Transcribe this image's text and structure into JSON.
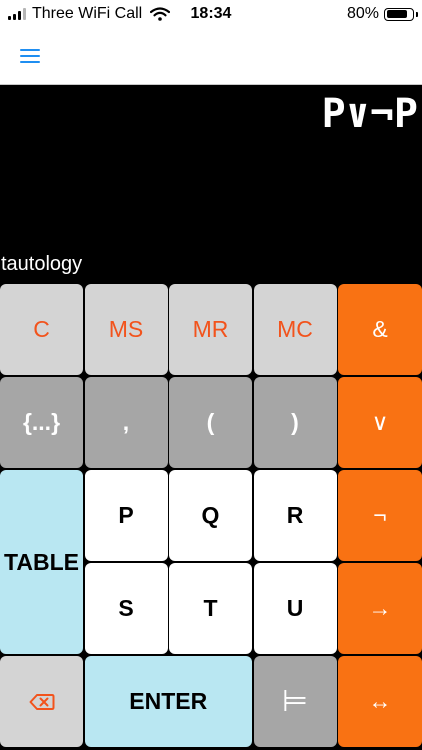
{
  "status_bar": {
    "carrier": "Three WiFi Call",
    "time": "18:34",
    "battery": "80%",
    "battery_level": 0.8,
    "signal_bars_active": 3,
    "signal_bars_total": 4
  },
  "nav": {
    "menu_icon": "hamburger-menu-icon",
    "accent": "#1f8ef1"
  },
  "display": {
    "expression": "P∨¬P",
    "result": "tautology"
  },
  "keys": {
    "clear": "C",
    "mem_store": "MS",
    "mem_recall": "MR",
    "mem_clear": "MC",
    "and": "&",
    "braces": "{...}",
    "comma": ",",
    "paren_open": "(",
    "paren_close": ")",
    "or": "∨",
    "table": "TABLE",
    "p": "P",
    "q": "Q",
    "r": "R",
    "not": "¬",
    "s": "S",
    "t": "T",
    "u": "U",
    "implies": "→",
    "backspace_icon": "backspace-icon",
    "enter": "ENTER",
    "turnstile": "⊨",
    "iff": "↔"
  },
  "colors": {
    "orange": "#f97213",
    "memory_text": "#f2531c",
    "light_key": "#d4d4d4",
    "gray_key": "#a6a6a6",
    "blue_key": "#b9e7f2"
  }
}
